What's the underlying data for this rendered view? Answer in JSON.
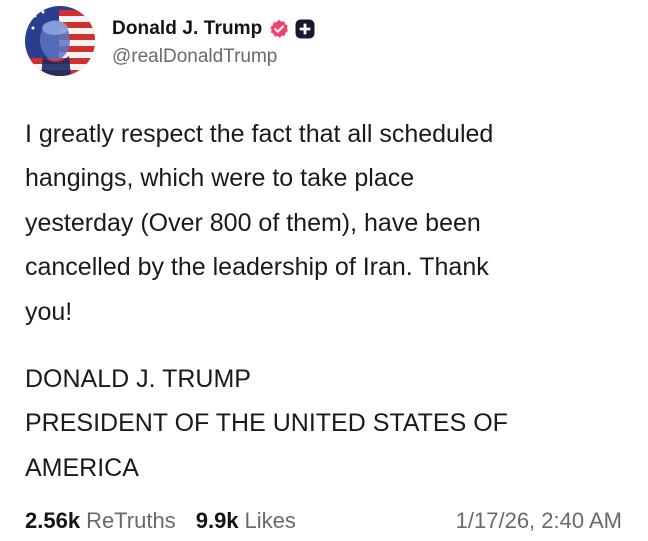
{
  "author": {
    "display_name": "Donald J. Trump",
    "handle": "@realDonaldTrump",
    "avatar_icon": "flag-portrait-avatar",
    "verified_icon": "verified-badge-icon",
    "verified_color": "#f0426e",
    "plus_icon": "plus-badge-icon"
  },
  "post": {
    "body": "I greatly respect the fact that all scheduled\nhangings, which were to take place\nyesterday (Over 800 of them), have been\ncancelled by the leadership of Iran. Thank\nyou!",
    "signature_line1": "DONALD J. TRUMP",
    "signature_line2": "PRESIDENT OF THE UNITED STATES OF",
    "signature_line3": "AMERICA"
  },
  "stats": {
    "retruths_count": "2.56k",
    "retruths_label": "ReTruths",
    "likes_count": "9.9k",
    "likes_label": "Likes",
    "timestamp": "1/17/26, 2:40 AM"
  }
}
